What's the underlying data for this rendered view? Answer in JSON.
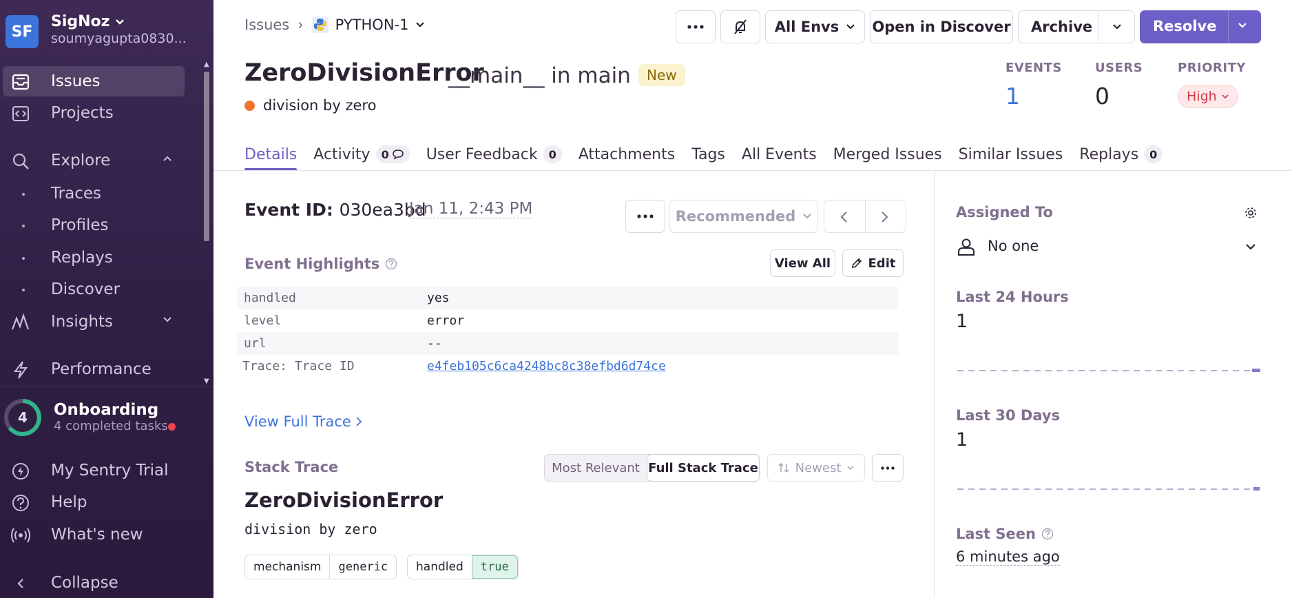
{
  "sidebar": {
    "org_initials": "SF",
    "org_name": "SigNoz",
    "org_user": "soumyagupta0830...",
    "nav": [
      {
        "label": "Issues",
        "icon": "issues-icon",
        "active": true
      },
      {
        "label": "Projects",
        "icon": "projects-icon"
      },
      {
        "label": "Explore",
        "icon": "search-icon"
      },
      {
        "label": "Insights",
        "icon": "insights-icon"
      },
      {
        "label": "Performance",
        "icon": "lightning-icon"
      }
    ],
    "explore_sub": [
      "Traces",
      "Profiles",
      "Replays",
      "Discover"
    ],
    "onboarding": {
      "count": "4",
      "title": "Onboarding",
      "subtitle": "4 completed tasks"
    },
    "bottom": [
      {
        "label": "My Sentry Trial"
      },
      {
        "label": "Help"
      },
      {
        "label": "What's new"
      },
      {
        "label": "Collapse"
      }
    ]
  },
  "header": {
    "breadcrumb_root": "Issues",
    "breadcrumb_sep": "›",
    "project": "PYTHON-1",
    "env": "All Envs",
    "open_discover": "Open in Discover",
    "archive": "Archive",
    "resolve": "Resolve",
    "title": "ZeroDivisionError",
    "subtitle": "__main__ in main",
    "badge": "New",
    "culprit": "division by zero",
    "stats": {
      "events_label": "EVENTS",
      "events": "1",
      "users_label": "USERS",
      "users": "0",
      "priority_label": "PRIORITY",
      "priority": "High"
    }
  },
  "tabs": [
    {
      "label": "Details",
      "active": true
    },
    {
      "label": "Activity",
      "count": "0"
    },
    {
      "label": "User Feedback",
      "count": "0"
    },
    {
      "label": "Attachments"
    },
    {
      "label": "Tags"
    },
    {
      "label": "All Events"
    },
    {
      "label": "Merged Issues"
    },
    {
      "label": "Similar Issues"
    },
    {
      "label": "Replays",
      "count": "0"
    }
  ],
  "event": {
    "id_label": "Event ID:",
    "id": "030ea3bd",
    "date": "Jan 11, 2:43 PM",
    "recommended": "Recommended",
    "highlights_title": "Event Highlights",
    "view_all": "View All",
    "edit": "Edit",
    "highlights": [
      {
        "k": "handled",
        "v": "yes"
      },
      {
        "k": "level",
        "v": "error"
      },
      {
        "k": "url",
        "v": "--"
      },
      {
        "k": "Trace: Trace ID",
        "v": "e4feb105c6ca4248bc8c38efbd6d74ce"
      }
    ],
    "view_full_trace": "View Full Trace",
    "stack_title": "Stack Trace",
    "most_relevant": "Most Relevant",
    "full_stack": "Full Stack Trace",
    "sort": "Newest",
    "exception_type": "ZeroDivisionError",
    "exception_msg": "division by zero",
    "tags": [
      {
        "k": "mechanism",
        "v": "generic"
      },
      {
        "k": "handled",
        "v": "true"
      }
    ]
  },
  "right": {
    "assigned_title": "Assigned To",
    "assignee": "No one",
    "last24_title": "Last 24 Hours",
    "last24": "1",
    "last30_title": "Last 30 Days",
    "last30": "1",
    "last_seen_title": "Last Seen",
    "last_seen": "6 minutes ago"
  },
  "colors": {
    "accent": "#6c5fc7",
    "link": "#3d74db",
    "sidebar": "#3e2a55",
    "danger": "#d13a47"
  }
}
